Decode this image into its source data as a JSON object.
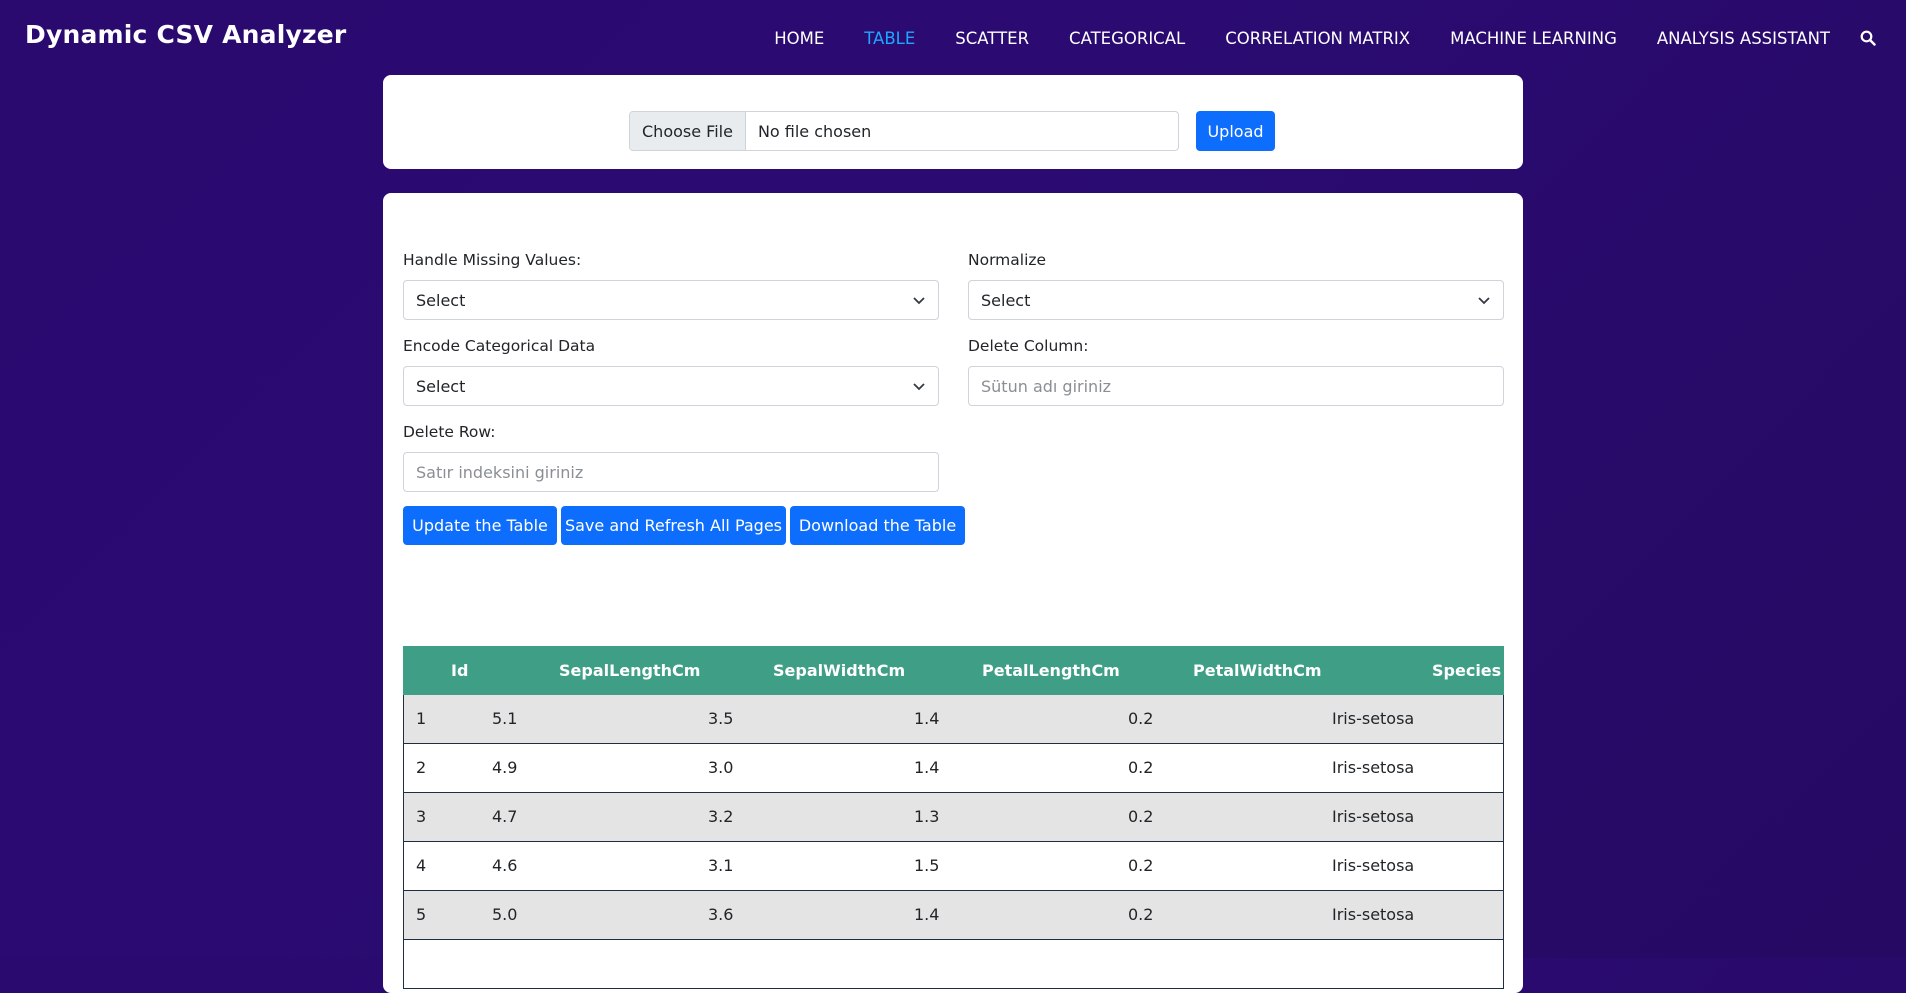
{
  "app": {
    "brand": "Dynamic CSV Analyzer"
  },
  "nav": {
    "items": [
      {
        "label": "HOME",
        "active": false
      },
      {
        "label": "TABLE",
        "active": true
      },
      {
        "label": "SCATTER",
        "active": false
      },
      {
        "label": "CATEGORICAL",
        "active": false
      },
      {
        "label": "CORRELATION MATRIX",
        "active": false
      },
      {
        "label": "MACHINE LEARNING",
        "active": false
      },
      {
        "label": "ANALYSIS ASSISTANT",
        "active": false
      }
    ],
    "search_icon": "search-icon",
    "active_color": "#1ea7ff"
  },
  "upload": {
    "choose_label": "Choose File",
    "file_status": "No file chosen",
    "upload_label": "Upload"
  },
  "controls": {
    "missing_label": "Handle Missing Values:",
    "missing_value": "Select",
    "normalize_label": "Normalize",
    "normalize_value": "Select",
    "encode_label": "Encode Categorical Data",
    "encode_value": "Select",
    "delete_column_label": "Delete Column:",
    "delete_column_placeholder": "Sütun adı giriniz",
    "delete_row_label": "Delete Row:",
    "delete_row_placeholder": "Satır indeksini giriniz"
  },
  "actions": {
    "update": "Update the Table",
    "save": "Save and Refresh All Pages",
    "download": "Download the Table"
  },
  "table": {
    "header_color": "#3f9f86",
    "columns": [
      "Id",
      "SepalLengthCm",
      "SepalWidthCm",
      "PetalLengthCm",
      "PetalWidthCm",
      "Species"
    ],
    "rows": [
      [
        "1",
        "5.1",
        "3.5",
        "1.4",
        "0.2",
        "Iris-setosa"
      ],
      [
        "2",
        "4.9",
        "3.0",
        "1.4",
        "0.2",
        "Iris-setosa"
      ],
      [
        "3",
        "4.7",
        "3.2",
        "1.3",
        "0.2",
        "Iris-setosa"
      ],
      [
        "4",
        "4.6",
        "3.1",
        "1.5",
        "0.2",
        "Iris-setosa"
      ],
      [
        "5",
        "5.0",
        "3.6",
        "1.4",
        "0.2",
        "Iris-setosa"
      ]
    ]
  },
  "colors": {
    "primary_button": "#0d6efd",
    "background": "#2a0a6e"
  }
}
